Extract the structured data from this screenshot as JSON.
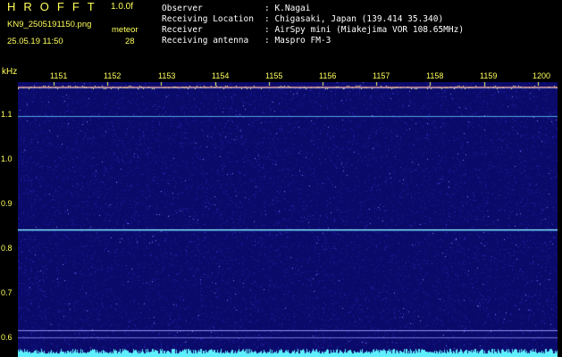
{
  "header": {
    "logo": "HROFFT",
    "version": "1.0.0f",
    "filename": "KN9_2505191150.png",
    "datetime": "25.05.19 11:50",
    "meteor_label": "meteor",
    "meteor_count": "28",
    "info": [
      {
        "label": "Observer",
        "value": ": K.Nagai"
      },
      {
        "label": "Receiving Location",
        "value": ": Chigasaki, Japan (139.414 35.340)"
      },
      {
        "label": "Receiver",
        "value": ": AirSpy mini (Miakejima VOR 108.65MHz)"
      },
      {
        "label": "Receiving antenna",
        "value": ": Maspro FM-3"
      }
    ]
  },
  "spectrogram": {
    "frequency_unit": "kHz",
    "time_ticks": [
      "1151",
      "1152",
      "1153",
      "1154",
      "1155",
      "1156",
      "1157",
      "1158",
      "1159",
      "1200"
    ],
    "freq_ticks": [
      "1.1",
      "1.0",
      "0.9",
      "0.8",
      "0.7",
      "0.6"
    ],
    "colors": {
      "background": "#0a0a6a",
      "label": "#ffff5a",
      "signal": "#5ef0ff"
    }
  }
}
